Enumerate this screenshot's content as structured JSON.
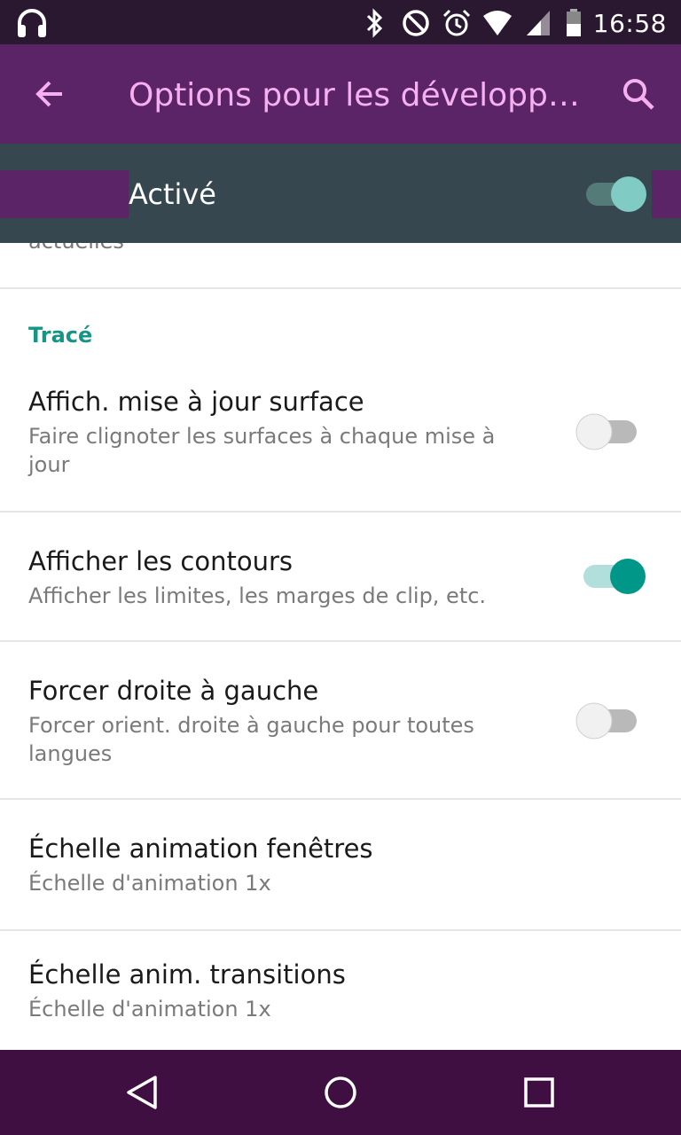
{
  "status_bar": {
    "time": "16:58",
    "icons": [
      "headphones-icon",
      "bluetooth-icon",
      "do-not-disturb-icon",
      "alarm-icon",
      "wifi-icon",
      "signal-icon",
      "battery-icon"
    ]
  },
  "app_bar": {
    "title": "Options pour les développ…",
    "icons": [
      "back-arrow-icon",
      "search-icon"
    ],
    "colors": {
      "background": "#5b2466",
      "title": "#f6b0f0"
    }
  },
  "master_switch": {
    "label": "Activé",
    "on": true
  },
  "list": {
    "partial_item_summary": "actuelles",
    "section_title": "Tracé",
    "items": [
      {
        "title": "Affich. mise à jour surface",
        "summary": "Faire clignoter les surfaces à chaque mise à jour",
        "switch_on": false
      },
      {
        "title": "Afficher les contours",
        "summary": "Afficher les limites, les marges de clip, etc.",
        "switch_on": true
      },
      {
        "title": "Forcer droite à gauche",
        "summary": "Forcer orient. droite à gauche pour toutes langues",
        "switch_on": false
      },
      {
        "title": "Échelle animation fenêtres",
        "summary": "Échelle d'animation 1x"
      },
      {
        "title": "Échelle anim. transitions",
        "summary": "Échelle d'animation 1x"
      }
    ]
  },
  "nav_bar": {
    "icons": [
      "back-triangle-icon",
      "home-circle-icon",
      "recents-square-icon"
    ]
  },
  "colors": {
    "accent": "#009688",
    "section": "#159586"
  }
}
